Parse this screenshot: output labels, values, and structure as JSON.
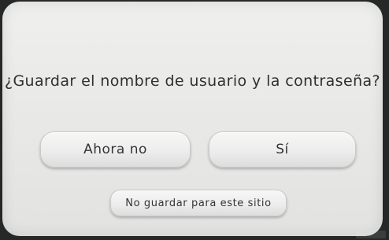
{
  "dialog": {
    "question": "¿Guardar el nombre de usuario y la contraseña?"
  },
  "buttons": {
    "not_now": "Ahora no",
    "yes": "Sí",
    "never_for_site": "No guardar para este sitio"
  }
}
